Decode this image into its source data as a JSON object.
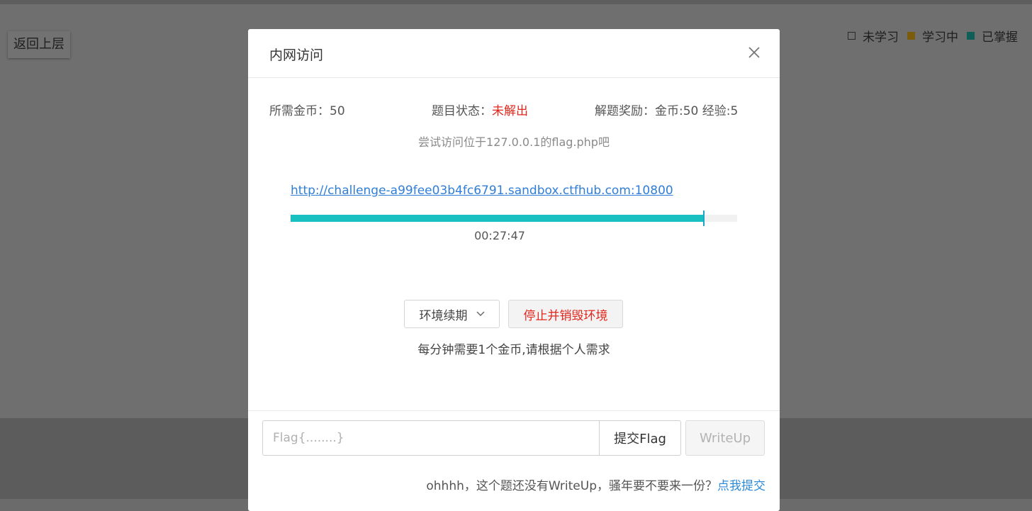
{
  "background": {
    "back_button": "返回上层",
    "legend": [
      {
        "label": "未学习",
        "color": "#ffffff"
      },
      {
        "label": "学习中",
        "color": "#7a5c0c"
      },
      {
        "label": "已掌握",
        "color": "#0f5f58"
      }
    ]
  },
  "modal": {
    "title": "内网访问",
    "info": {
      "cost_label": "所需金币：",
      "cost_value": "50",
      "status_label": "题目状态：",
      "status_value": "未解出",
      "reward_label": "解题奖励：",
      "reward_value": "金币:50 经验:5"
    },
    "hint": "尝试访问位于127.0.0.1的flag.php吧",
    "env_url": "http://challenge-a99fee03b4fc6791.sandbox.ctfhub.com:10800",
    "progress": 0.926,
    "timer": "00:27:47",
    "renew_label": "环境续期",
    "stop_label": "停止并销毁环境",
    "cost_note": "每分钟需要1个金币,请根据个人需求",
    "flag_placeholder": "Flag{........}",
    "submit_label": "提交Flag",
    "writeup_label": "WriteUp",
    "writeup_note": "ohhhh，这个题还没有WriteUp，骚年要不要来一份？",
    "writeup_link": "点我提交"
  },
  "colors": {
    "accent_teal": "#19c0c0",
    "link_blue": "#2f7ed8",
    "danger_red": "#e3261c"
  }
}
